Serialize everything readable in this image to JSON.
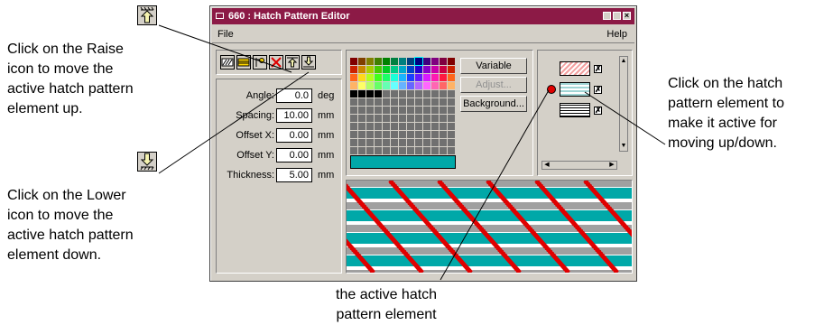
{
  "window": {
    "title": "660 : Hatch Pattern Editor",
    "menu": {
      "file": "File",
      "help": "Help"
    }
  },
  "fields": {
    "angle": {
      "label": "Angle:",
      "value": "0.0",
      "unit": "deg"
    },
    "spacing": {
      "label": "Spacing:",
      "value": "10.00",
      "unit": "mm"
    },
    "offset_x": {
      "label": "Offset X:",
      "value": "0.00",
      "unit": "mm"
    },
    "offset_y": {
      "label": "Offset Y:",
      "value": "0.00",
      "unit": "mm"
    },
    "thickness": {
      "label": "Thickness:",
      "value": "5.00",
      "unit": "mm"
    }
  },
  "buttons": {
    "variable": "Variable",
    "adjust": "Adjust...",
    "background": "Background..."
  },
  "selected_color": "#00a8a8",
  "element_checks": [
    "✗",
    "✗",
    "✗"
  ],
  "callouts": {
    "raise": "Click on the Raise\nicon to move the\nactive hatch pattern\nelement up.",
    "lower": "Click on the Lower\nicon to move the\nactive hatch pattern\nelement down.",
    "hatch": "Click on the hatch\npattern element to\nmake it active for\nmoving up/down.",
    "active": "the active hatch\npattern element"
  },
  "colors": {
    "title_bar": "#8c1a46",
    "teal": "#00a8a8",
    "red": "#e00000"
  }
}
